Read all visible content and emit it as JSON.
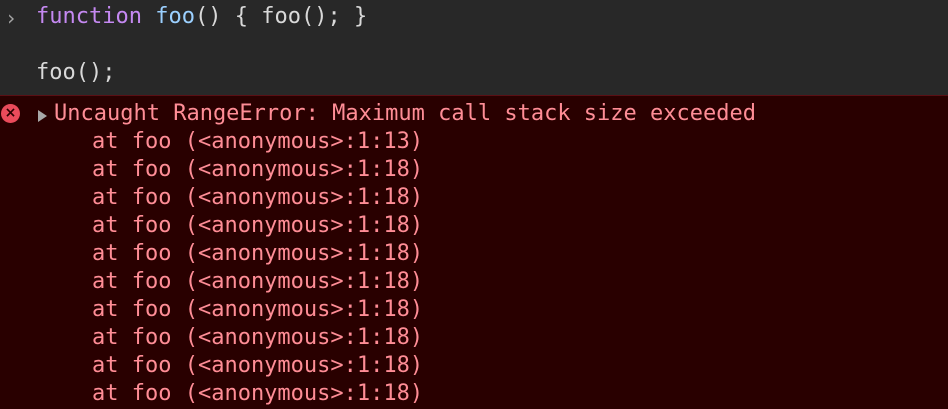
{
  "console": {
    "prompt_icon": "chevron-right-icon",
    "input": {
      "line1": {
        "keyword": "function",
        "function_name": "foo",
        "parens": "()",
        "space_open": " { ",
        "call": "foo();",
        "close": " }"
      },
      "line2": "foo();"
    },
    "error": {
      "icon": "error-x-icon",
      "expand_icon": "triangle-right-icon",
      "message": "Uncaught RangeError: Maximum call stack size exceeded",
      "stack": [
        "at foo (<anonymous>:1:13)",
        "at foo (<anonymous>:1:18)",
        "at foo (<anonymous>:1:18)",
        "at foo (<anonymous>:1:18)",
        "at foo (<anonymous>:1:18)",
        "at foo (<anonymous>:1:18)",
        "at foo (<anonymous>:1:18)",
        "at foo (<anonymous>:1:18)",
        "at foo (<anonymous>:1:18)",
        "at foo (<anonymous>:1:18)"
      ]
    }
  },
  "colors": {
    "background": "#282828",
    "error_background": "#290000",
    "error_text": "#ff8d96",
    "keyword": "#c589f2",
    "function_name": "#9bd0ff"
  }
}
